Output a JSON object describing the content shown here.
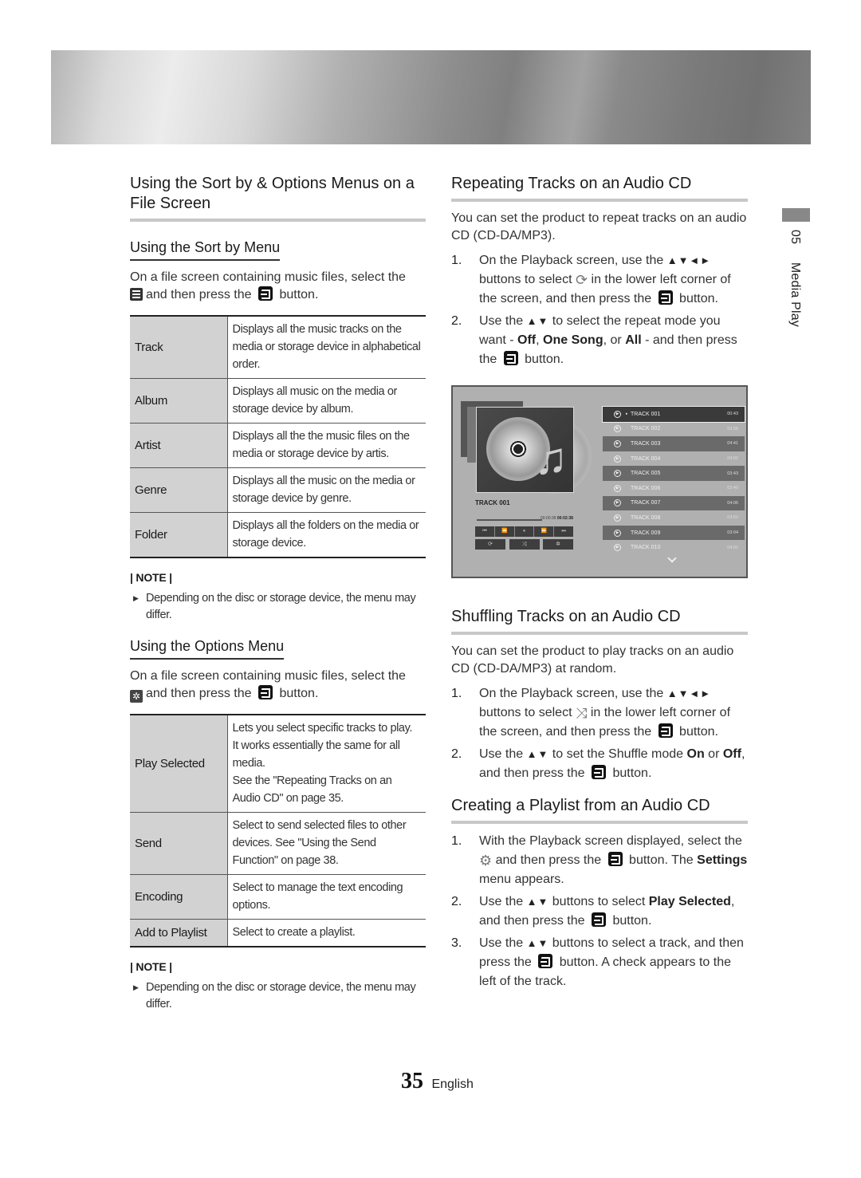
{
  "left": {
    "main_title": "Using the Sort by & Options Menus on a File Screen",
    "sort_section": {
      "title": "Using the Sort by Menu",
      "intro_before": "On a file screen containing music files, select the",
      "intro_icon": "list-icon",
      "intro_mid": "and then press the",
      "intro_after": "button.",
      "table": [
        {
          "key": "Track",
          "value": "Displays all the music tracks on the media or storage device in alphabetical order."
        },
        {
          "key": "Album",
          "value": "Displays all music on the media or storage device by album."
        },
        {
          "key": "Artist",
          "value": "Displays all the the music files on the media or storage device by artis."
        },
        {
          "key": "Genre",
          "value": "Displays all the music on the media or storage device by genre."
        },
        {
          "key": "Folder",
          "value": "Displays all the folders on the media or storage device."
        }
      ],
      "note_heading": "| NOTE |",
      "note_text": "Depending on the disc or storage device, the menu may differ."
    },
    "options_section": {
      "title": "Using the Options Menu",
      "intro_before": "On a file screen containing music files, select the",
      "intro_icon": "gear-icon",
      "intro_mid": "and then press the",
      "intro_after": "button.",
      "table": [
        {
          "key": "Play Selected",
          "value_lines": [
            "Lets you select specific tracks to play.",
            "It works essentially the same for all media.",
            "See the \"Repeating Tracks on an Audio CD\" on page 35."
          ]
        },
        {
          "key": "Send",
          "value_lines": [
            "Select to send selected files to other devices. See \"Using the Send Function\" on page 38."
          ]
        },
        {
          "key": "Encoding",
          "value_lines": [
            "Select to manage the text encoding options."
          ]
        },
        {
          "key": "Add to Playlist",
          "value_lines": [
            "Select to create a playlist."
          ]
        }
      ],
      "note_heading": "| NOTE |",
      "note_text": "Depending on the disc or storage device, the menu may differ."
    }
  },
  "right": {
    "repeat": {
      "title": "Repeating Tracks on an Audio CD",
      "intro": "You can set the product to repeat tracks on an audio CD (CD-DA/MP3).",
      "step1": {
        "num": "1.",
        "a": "On the Playback screen, use the",
        "arrows": "▲▼◄►",
        "b": "buttons to select",
        "c": "in the lower left corner of the screen, and then press the",
        "d": "button."
      },
      "step2": {
        "num": "2.",
        "a": "Use the",
        "arrows": "▲▼",
        "b": "to select the repeat mode you want -",
        "opt1": "Off",
        "sep1": ",",
        "opt2": "One Song",
        "sep2": ", or",
        "opt3": "All",
        "c": "- and then press the",
        "d": "button."
      }
    },
    "player_screen": {
      "now_playing": "TRACK 001",
      "elapsed": "00:00:38",
      "total": "00:02:38",
      "controls": [
        "⏮",
        "⏪",
        "⏸",
        "⏩",
        "⏭"
      ],
      "mode_buttons": [
        "repeat",
        "shuffle",
        "settings"
      ],
      "tracks": [
        {
          "name": "TRACK 001",
          "time": "00:43",
          "selected": true
        },
        {
          "name": "TRACK 002",
          "time": "03:56"
        },
        {
          "name": "TRACK 003",
          "time": "04:41"
        },
        {
          "name": "TRACK 004",
          "time": "04:02"
        },
        {
          "name": "TRACK 005",
          "time": "03:43"
        },
        {
          "name": "TRACK 006",
          "time": "03:40"
        },
        {
          "name": "TRACK 007",
          "time": "04:06"
        },
        {
          "name": "TRACK 008",
          "time": "03:52"
        },
        {
          "name": "TRACK 009",
          "time": "03:04"
        },
        {
          "name": "TRACK 010",
          "time": "04:02"
        }
      ]
    },
    "shuffle": {
      "title": "Shuffling Tracks on an Audio CD",
      "intro": "You can set the product to play tracks on an audio CD (CD-DA/MP3) at random.",
      "step1": {
        "num": "1.",
        "a": "On the Playback screen, use the",
        "arrows": "▲▼◄►",
        "b": "buttons to select",
        "c": "in the lower left corner of the screen, and then press the",
        "d": "button."
      },
      "step2": {
        "num": "2.",
        "a": "Use the",
        "arrows": "▲▼",
        "b": "to set the Shuffle mode",
        "opt1": "On",
        "c": "or",
        "opt2": "Off",
        "d": ", and then press the",
        "e": "button."
      }
    },
    "playlist": {
      "title": "Creating a Playlist from an Audio CD",
      "step1": {
        "num": "1.",
        "a": "With the Playback screen displayed, select the",
        "b": "and then press the",
        "c": "button. The",
        "bold": "Settings",
        "d": "menu appears."
      },
      "step2": {
        "num": "2.",
        "a": "Use the",
        "arrows": "▲▼",
        "b": "buttons to select",
        "bold": "Play Selected",
        "c": ", and then press the",
        "d": "button."
      },
      "step3": {
        "num": "3.",
        "a": "Use the",
        "arrows": "▲▼",
        "b": "buttons to select a track, and then press the",
        "c": "button. A check appears to the left of the track."
      }
    }
  },
  "side": {
    "chapter": "05",
    "label": "Media Play"
  },
  "footer": {
    "page": "35",
    "language": "English"
  }
}
